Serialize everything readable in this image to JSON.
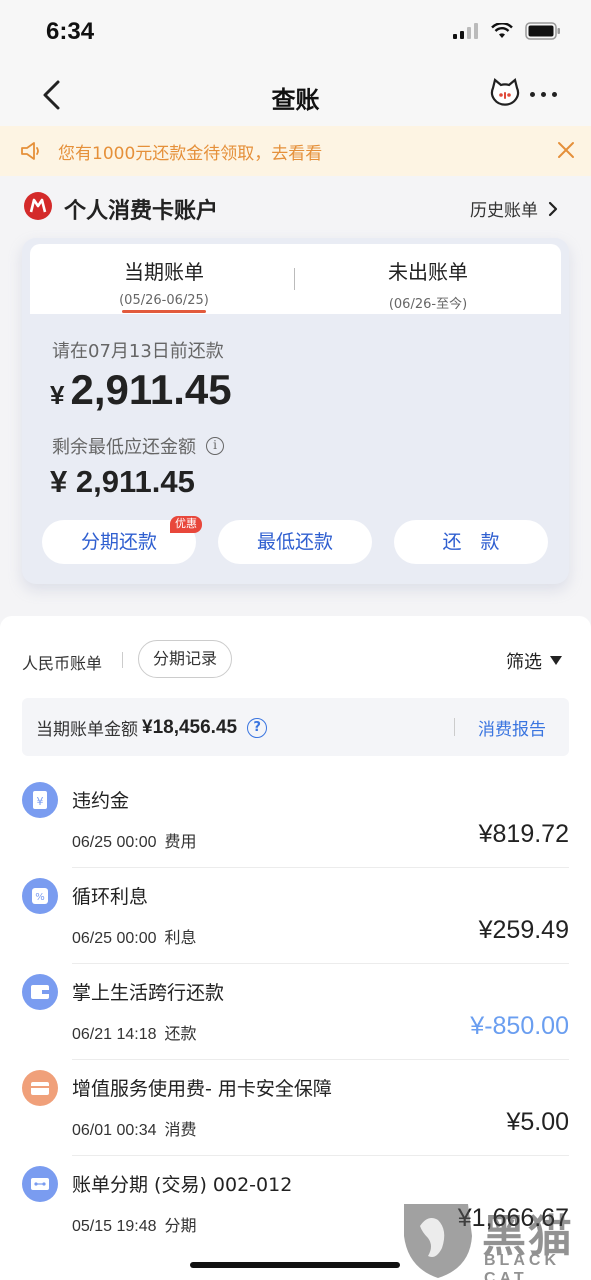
{
  "status_bar": {
    "time": "6:34"
  },
  "nav": {
    "title": "查账"
  },
  "notice": {
    "text": "您有1000元还款金待领取，去看看"
  },
  "account": {
    "title": "个人消费卡账户",
    "history_link": "历史账单"
  },
  "bill_card": {
    "tabs": [
      {
        "label": "当期账单",
        "period": "(05/26-06/25)",
        "active": true
      },
      {
        "label": "未出账单",
        "period": "(06/26-至今)",
        "active": false
      }
    ],
    "due_label": "请在07月13日前还款",
    "due_currency": "¥",
    "due_amount": "2,911.45",
    "min_label": "剩余最低应还金额",
    "min_amount": "¥ 2,911.45",
    "buttons": [
      {
        "label": "分期还款",
        "badge": "优惠"
      },
      {
        "label": "最低还款"
      },
      {
        "label": "还　款"
      }
    ]
  },
  "list": {
    "rmb_label": "人民币账单",
    "installment_record": "分期记录",
    "filter_label": "筛选",
    "summary_label": "当期账单金额",
    "summary_amount": "¥18,456.45",
    "summary_help": "?",
    "report_link": "消费报告",
    "transactions": [
      {
        "title": "违约金",
        "datetime": "06/25 00:00",
        "category": "费用",
        "amount": "¥819.72",
        "icon": "yen-icon",
        "icon_color": "#7a9cf0"
      },
      {
        "title": "循环利息",
        "datetime": "06/25 00:00",
        "category": "利息",
        "amount": "¥259.49",
        "icon": "percent-icon",
        "icon_color": "#7a9cf0"
      },
      {
        "title": "掌上生活跨行还款",
        "datetime": "06/21 14:18",
        "category": "还款",
        "amount": "¥-850.00",
        "icon": "wallet-icon",
        "icon_color": "#7a9cf0"
      },
      {
        "title": "增值服务使用费- 用卡安全保障",
        "datetime": "06/01 00:34",
        "category": "消费",
        "amount": "¥5.00",
        "icon": "shop-icon",
        "icon_color": "#f0a07a"
      },
      {
        "title": "账单分期 (交易) 002-012",
        "datetime": "05/15 19:48",
        "category": "分期",
        "amount": "¥1,666.67",
        "icon": "installment-icon",
        "icon_color": "#7a9cf0"
      }
    ]
  },
  "watermark": {
    "cn": "黑猫",
    "en": "BLACK CAT"
  },
  "colors": {
    "accent_blue": "#3a75e0",
    "credit_blue": "#6a9ef0",
    "notice_orange": "#e5903a",
    "brand_red": "#d42a2a"
  }
}
